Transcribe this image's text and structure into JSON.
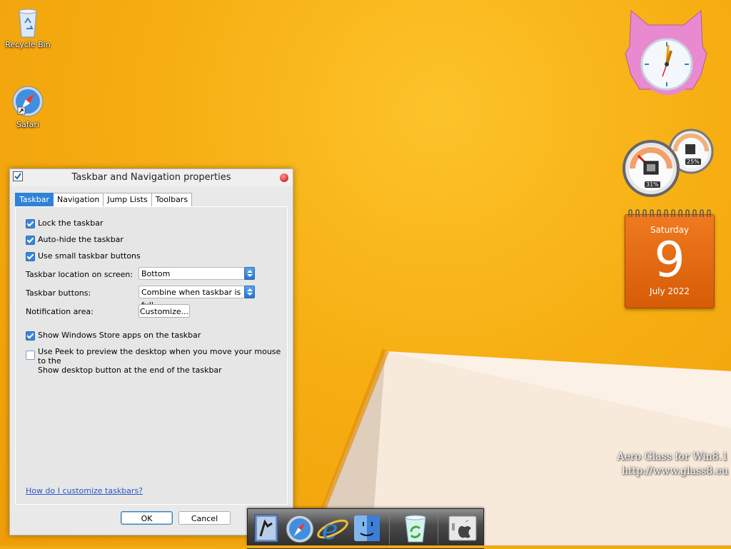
{
  "desktop": {
    "icons": [
      {
        "label": "Recycle Bin",
        "icon": "recycle-bin-icon"
      },
      {
        "label": "Safari",
        "icon": "safari-icon"
      }
    ],
    "watermark": {
      "line1": "Aero Glass for Win8.1",
      "line2": "http://www.glass8.eu"
    }
  },
  "gadgets": {
    "clock": {
      "icon": "clock-gadget-icon"
    },
    "meter": {
      "cpu_percent": 31,
      "cpu_label": "31%",
      "memory_percent": 25,
      "memory_label": "25%"
    },
    "calendar": {
      "weekday": "Saturday",
      "day": "9",
      "month_year": "July 2022"
    }
  },
  "dialog": {
    "title": "Taskbar and Navigation properties",
    "tabs": [
      "Taskbar",
      "Navigation",
      "Jump Lists",
      "Toolbars"
    ],
    "active_tab": "Taskbar",
    "options": {
      "lock": {
        "label": "Lock the taskbar",
        "checked": true
      },
      "autohide": {
        "label": "Auto-hide the taskbar",
        "checked": true
      },
      "small": {
        "label": "Use small taskbar buttons",
        "checked": true
      },
      "store": {
        "label": "Show Windows Store apps on the taskbar",
        "checked": true
      },
      "peek": {
        "label_line1": "Use Peek to preview the desktop when you move your mouse to the",
        "label_line2": "Show desktop button at the end of the taskbar",
        "checked": false
      }
    },
    "location": {
      "label": "Taskbar location on screen:",
      "value": "Bottom"
    },
    "buttons": {
      "label": "Taskbar buttons:",
      "value": "Combine when taskbar is full"
    },
    "notification": {
      "label": "Notification area:",
      "button": "Customize..."
    },
    "help_link": "How do I customize taskbars?",
    "ok": "OK",
    "cancel": "Cancel"
  },
  "dock": {
    "items": [
      "mail-icon",
      "safari-icon",
      "internet-explorer-icon",
      "finder-icon",
      "recycle-bin-icon",
      "boot-camp-icon"
    ]
  },
  "colors": {
    "accent": "#2f82d6",
    "desktop": "#f5b00f",
    "calendar": "#e86a12"
  }
}
